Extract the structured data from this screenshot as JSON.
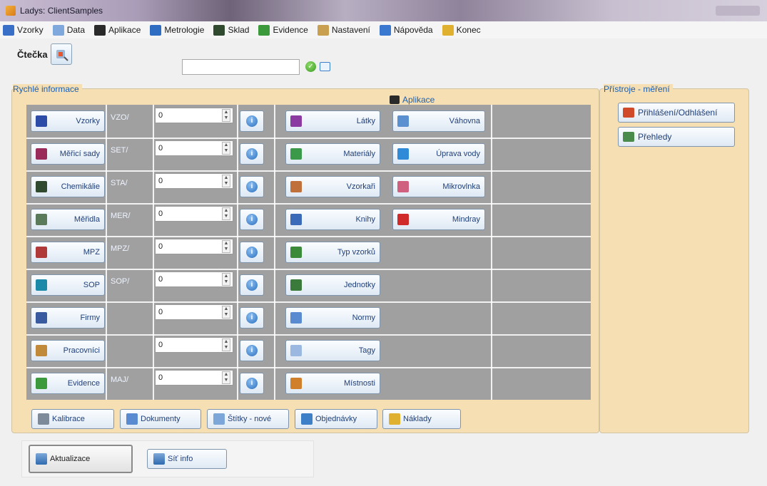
{
  "window": {
    "title": "Ladys: ClientSamples"
  },
  "menu": [
    {
      "label": "Vzorky",
      "icon": "vials-icon",
      "color": "#3a6fc7"
    },
    {
      "label": "Data",
      "icon": "data-icon",
      "color": "#7fa8dc"
    },
    {
      "label": "Aplikace",
      "icon": "app-icon",
      "color": "#2a2a2a"
    },
    {
      "label": "Metrologie",
      "icon": "chart-icon",
      "color": "#2f6dc2"
    },
    {
      "label": "Sklad",
      "icon": "flask-icon",
      "color": "#2f4a2f"
    },
    {
      "label": "Evidence",
      "icon": "book-icon",
      "color": "#3c9a3c"
    },
    {
      "label": "Nastavení",
      "icon": "wrench-icon",
      "color": "#c9a050"
    },
    {
      "label": "Nápověda",
      "icon": "help-icon",
      "color": "#3b78d0"
    },
    {
      "label": "Konec",
      "icon": "exit-icon",
      "color": "#e0b030"
    }
  ],
  "reader": {
    "label": "Čtečka"
  },
  "panels": {
    "quick_info": "Rychlé informace",
    "applications": "Aplikace",
    "instruments": "Přístroje - měření"
  },
  "rows": [
    {
      "btn": "Vzorky",
      "prefix": "VZO/",
      "value": "0",
      "icon_color": "#2c4ca8",
      "mid": "Látky",
      "mid_color": "#8a3aa0",
      "app": "Váhovna",
      "app_color": "#5a8fd0"
    },
    {
      "btn": "Měřicí sady",
      "prefix": "SET/",
      "value": "0",
      "icon_color": "#9a2a5a",
      "mid": "Materiály",
      "mid_color": "#3a9a4a",
      "app": "Úprava vody",
      "app_color": "#2f8ad8"
    },
    {
      "btn": "Chemikálie",
      "prefix": "STA/",
      "value": "0",
      "icon_color": "#2f4a2f",
      "mid": "Vzorkaři",
      "mid_color": "#c0703a",
      "app": "Mikrovlnka",
      "app_color": "#d06080"
    },
    {
      "btn": "Měřidla",
      "prefix": "MER/",
      "value": "0",
      "icon_color": "#5a7a5a",
      "mid": "Knihy",
      "mid_color": "#3a6ab8",
      "app": "Mindray",
      "app_color": "#d02a2a"
    },
    {
      "btn": "MPZ",
      "prefix": "MPZ/",
      "value": "0",
      "icon_color": "#b03a3a",
      "mid": "Typ vzorků",
      "mid_color": "#3a8a3a",
      "app": "",
      "app_color": ""
    },
    {
      "btn": "SOP",
      "prefix": "SOP/",
      "value": "0",
      "icon_color": "#1a8aa8",
      "mid": "Jednotky",
      "mid_color": "#3a7a3a",
      "app": "",
      "app_color": ""
    },
    {
      "btn": "Firmy",
      "prefix": "",
      "value": "0",
      "icon_color": "#3a5aa0",
      "mid": "Normy",
      "mid_color": "#5a8ad0",
      "app": "",
      "app_color": ""
    },
    {
      "btn": "Pracovníci",
      "prefix": "",
      "value": "0",
      "icon_color": "#c08a3a",
      "mid": "Tagy",
      "mid_color": "#9ab8e0",
      "app": "",
      "app_color": ""
    },
    {
      "btn": "Evidence",
      "prefix": "MAJ/",
      "value": "0",
      "icon_color": "#3c9a3c",
      "mid": "Místnosti",
      "mid_color": "#d0802a",
      "app": "",
      "app_color": ""
    }
  ],
  "bottom_buttons": [
    {
      "label": "Kalibrace",
      "icon": "chart-line-icon"
    },
    {
      "label": "Dokumenty",
      "icon": "document-icon"
    },
    {
      "label": "Štítky - nové",
      "icon": "label-icon"
    },
    {
      "label": "Objednávky",
      "icon": "window-icon"
    },
    {
      "label": "Náklady",
      "icon": "coins-icon"
    }
  ],
  "instrument_buttons": [
    {
      "label": "Přihlášení/Odhlášení",
      "icon": "arrows-icon"
    },
    {
      "label": "Přehledy",
      "icon": "overview-icon"
    }
  ],
  "footer_buttons": [
    {
      "label": "Aktualizace"
    },
    {
      "label": "Síť info"
    }
  ]
}
